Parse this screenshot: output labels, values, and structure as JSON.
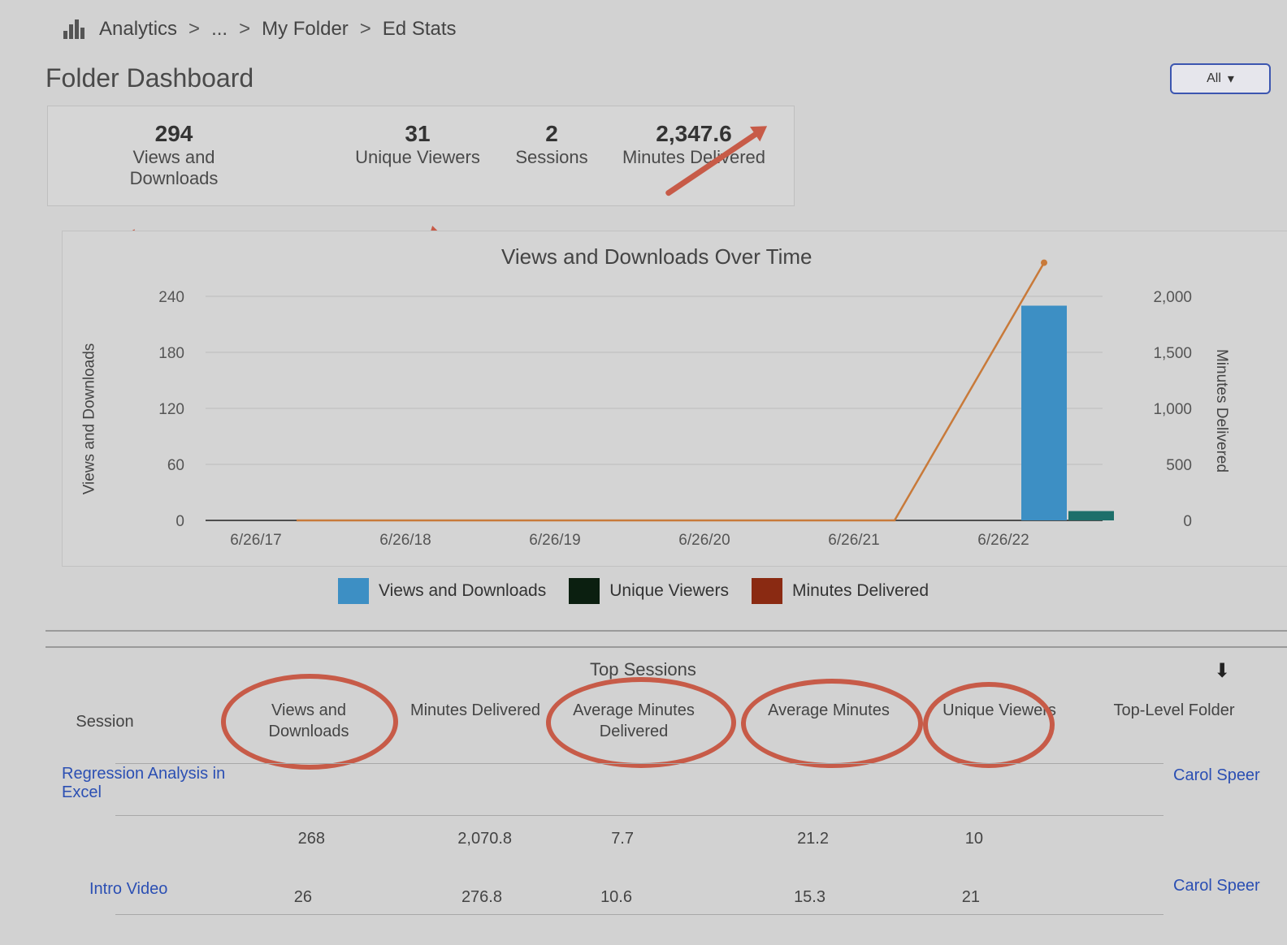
{
  "breadcrumb": {
    "items": [
      "Analytics",
      "...",
      "My Folder",
      "Ed Stats"
    ],
    "separator": ">"
  },
  "header": {
    "title": "Folder Dashboard",
    "scope_button": "All"
  },
  "summary": {
    "stats": [
      {
        "value": "294",
        "label": "Views and Downloads"
      },
      {
        "value": "31",
        "label": "Unique Viewers"
      },
      {
        "value": "2",
        "label": "Sessions"
      },
      {
        "value": "2,347.6",
        "label": "Minutes Delivered"
      }
    ]
  },
  "chart": {
    "title": "Views and Downloads Over Time",
    "y_left_label": "Views and Downloads",
    "y_right_label": "Minutes Delivered",
    "left_ticks": [
      "0",
      "60",
      "120",
      "180",
      "240"
    ],
    "right_ticks": [
      "0",
      "500",
      "1,000",
      "1,500",
      "2,000"
    ],
    "x_ticks": [
      "6/26/17",
      "6/26/18",
      "6/26/19",
      "6/26/20",
      "6/26/21",
      "6/26/22"
    ]
  },
  "chart_data": {
    "type": "bar",
    "title": "Views and Downloads Over Time",
    "xlabel": "",
    "ylabel": "Views and Downloads",
    "categories": [
      "6/26/17",
      "6/26/18",
      "6/26/19",
      "6/26/20",
      "6/26/21",
      "6/26/22"
    ],
    "ylim": [
      0,
      240
    ],
    "y2lim": [
      0,
      2000
    ],
    "series": [
      {
        "name": "Views and Downloads",
        "kind": "bar",
        "values": [
          0,
          0,
          0,
          0,
          0,
          230
        ]
      },
      {
        "name": "Unique Viewers",
        "kind": "bar",
        "values": [
          0,
          0,
          0,
          0,
          0,
          10
        ]
      },
      {
        "name": "Minutes Delivered",
        "kind": "line",
        "axis": "right",
        "values": [
          0,
          0,
          0,
          0,
          0,
          2300
        ]
      }
    ],
    "legend": "bottom"
  },
  "legend": {
    "items": [
      {
        "label": "Views and Downloads",
        "color": "#3d8fc4"
      },
      {
        "label": "Unique Viewers",
        "color": "#0b1f10"
      },
      {
        "label": "Minutes Delivered",
        "color": "#8a2a12"
      }
    ]
  },
  "top_sessions": {
    "title": "Top Sessions",
    "columns": [
      "Session",
      "Views and Downloads",
      "Minutes Delivered",
      "Average Minutes Delivered",
      "Average Minutes",
      "Unique Viewers",
      "Top-Level Folder"
    ],
    "rows": [
      {
        "session": "Regression Analysis in Excel",
        "views": "268",
        "minutes": "2,070.8",
        "avg_delivered": "7.7",
        "avg_minutes": "21.2",
        "unique": "10",
        "folder": "Carol Speer"
      },
      {
        "session": "Intro Video",
        "views": "26",
        "minutes": "276.8",
        "avg_delivered": "10.6",
        "avg_minutes": "15.3",
        "unique": "21",
        "folder": "Carol Speer"
      }
    ]
  },
  "colors": {
    "annotation_red": "#c75b48",
    "link_blue": "#2b4fb3",
    "bar_blue": "#3d8fc4",
    "line_orange": "#c87a3a"
  }
}
